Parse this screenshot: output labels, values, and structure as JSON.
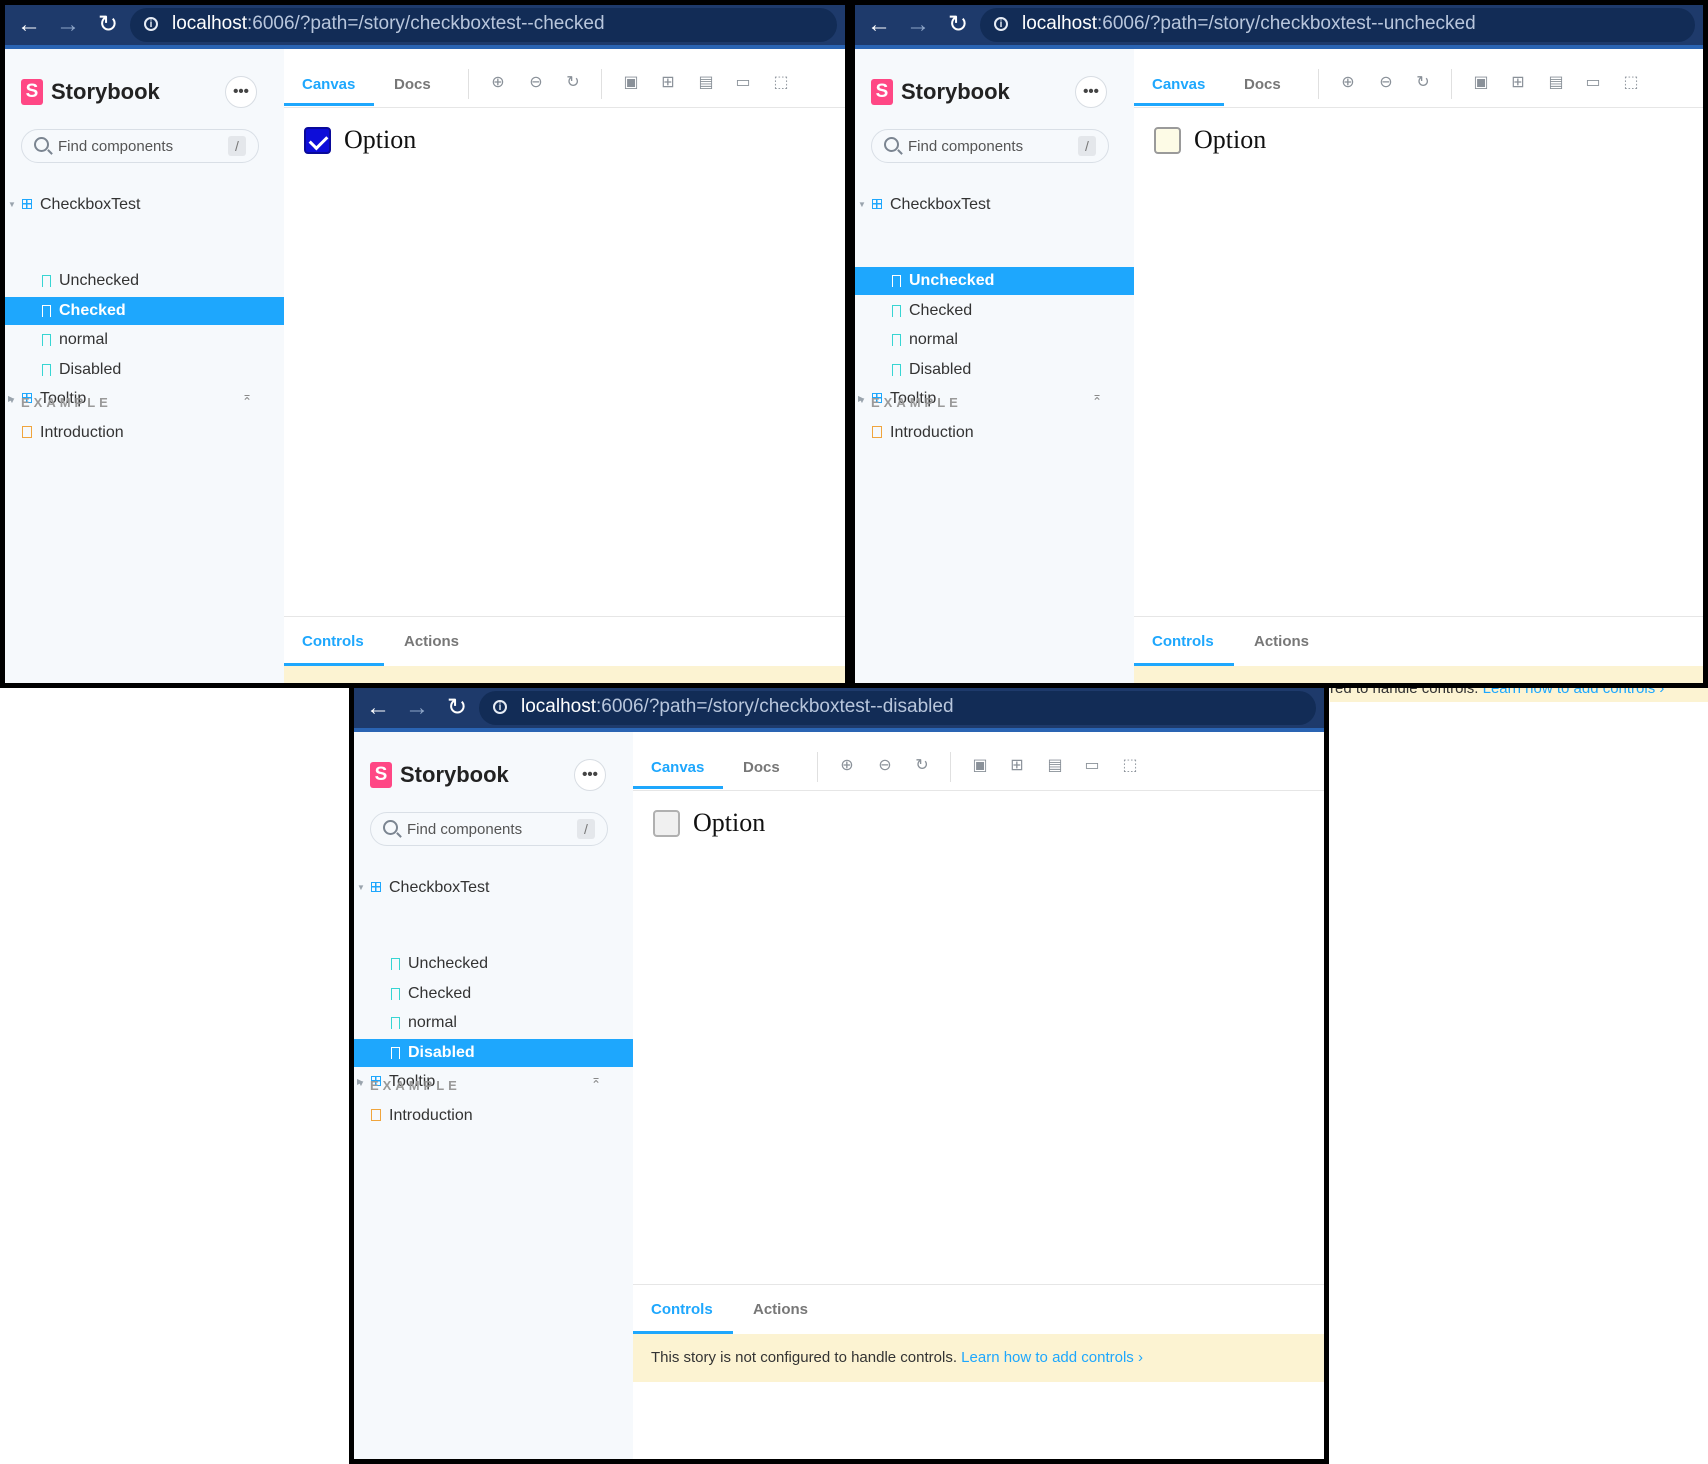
{
  "screens": [
    {
      "url_host": "localhost",
      "url_rest": ":6006/?path=/story/checkboxtest--checked",
      "brand": "Storybook",
      "search_placeholder": "Find components",
      "search_shortcut": "/",
      "tree": {
        "group": "CheckboxTest",
        "stories": [
          "Unchecked",
          "Checked",
          "normal",
          "Disabled"
        ],
        "selected": "Checked",
        "tooltip": "Tooltip"
      },
      "section": "EXAMPLE",
      "doc": "Introduction",
      "tabs": [
        "Canvas",
        "Docs"
      ],
      "checkbox_state": "checked",
      "checkbox_label": "Option",
      "addon_tabs": [
        "Controls",
        "Actions"
      ]
    },
    {
      "url_host": "localhost",
      "url_rest": ":6006/?path=/story/checkboxtest--unchecked",
      "brand": "Storybook",
      "search_placeholder": "Find components",
      "search_shortcut": "/",
      "tree": {
        "group": "CheckboxTest",
        "stories": [
          "Unchecked",
          "Checked",
          "normal",
          "Disabled"
        ],
        "selected": "Unchecked",
        "tooltip": "Tooltip"
      },
      "section": "EXAMPLE",
      "doc": "Introduction",
      "tabs": [
        "Canvas",
        "Docs"
      ],
      "checkbox_state": "unchecked",
      "checkbox_label": "Option",
      "addon_tabs": [
        "Controls",
        "Actions"
      ]
    },
    {
      "url_host": "localhost",
      "url_rest": ":6006/?path=/story/checkboxtest--disabled",
      "brand": "Storybook",
      "search_placeholder": "Find components",
      "search_shortcut": "/",
      "tree": {
        "group": "CheckboxTest",
        "stories": [
          "Unchecked",
          "Checked",
          "normal",
          "Disabled"
        ],
        "selected": "Disabled",
        "tooltip": "Tooltip"
      },
      "section": "EXAMPLE",
      "doc": "Introduction",
      "tabs": [
        "Canvas",
        "Docs"
      ],
      "checkbox_state": "disabled",
      "checkbox_label": "Option",
      "addon_tabs": [
        "Controls",
        "Actions"
      ],
      "warning_text": "This story is not configured to handle controls.",
      "warning_link": "Learn how to add controls ›"
    }
  ],
  "peek_text": {
    "text": "red to handle controls.",
    "link": "Learn how to add controls ›"
  },
  "colors": {
    "accent": "#1ea7fd",
    "brand": "#ff4785",
    "urlbar": "#1e3a6b",
    "warning_bg": "#fcf3d2",
    "checkbox_checked": "#0d0dd9"
  }
}
